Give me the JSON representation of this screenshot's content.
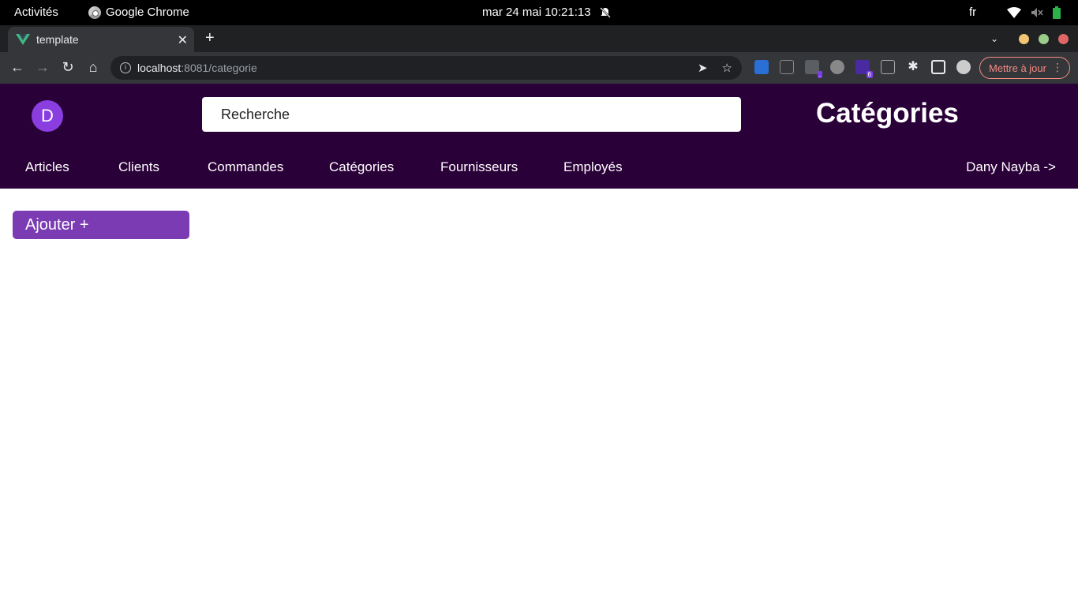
{
  "system": {
    "activities": "Activités",
    "app_name": "Google Chrome",
    "clock": "mar 24 mai  10:21:13",
    "lang": "fr"
  },
  "browser": {
    "tab_title": "template",
    "url_host": "localhost",
    "url_rest": ":8081/categorie",
    "update_label": "Mettre à jour",
    "ext_badge": "6"
  },
  "header": {
    "avatar_letter": "D",
    "search_placeholder": "Recherche",
    "title": "Catégories"
  },
  "nav": {
    "items": [
      "Articles",
      "Clients",
      "Commandes",
      "Catégories",
      "Fournisseurs",
      "Employés"
    ],
    "user": "Dany Nayba ->"
  },
  "main": {
    "add_label": "Ajouter +"
  },
  "colors": {
    "header_bg": "#2a0038",
    "accent": "#7a3bb3",
    "avatar": "#8a3ee0"
  }
}
